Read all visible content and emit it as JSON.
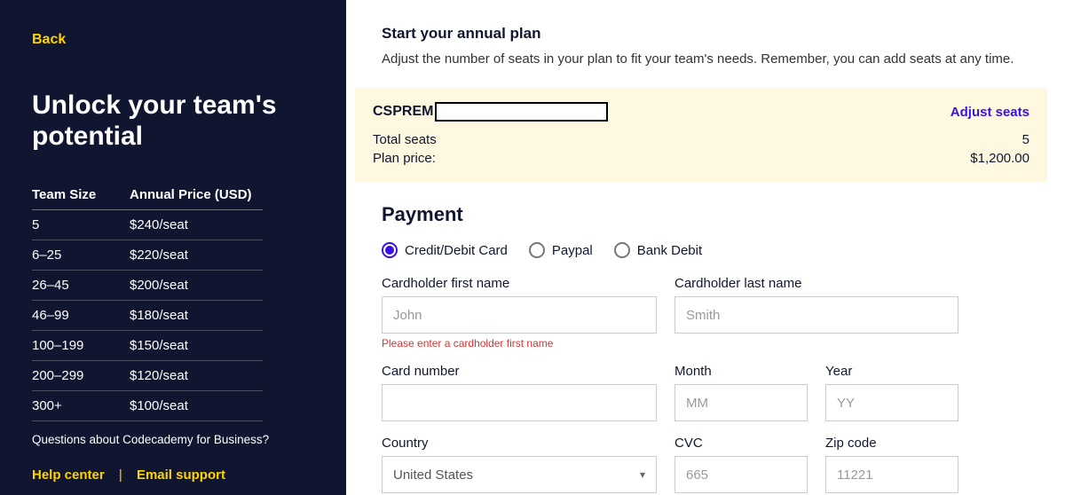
{
  "sidebar": {
    "back": "Back",
    "title": "Unlock your team's potential",
    "table": {
      "col_size": "Team Size",
      "col_price": "Annual Price (USD)",
      "rows": [
        {
          "size": "5",
          "price": "$240/seat"
        },
        {
          "size": "6–25",
          "price": "$220/seat"
        },
        {
          "size": "26–45",
          "price": "$200/seat"
        },
        {
          "size": "46–99",
          "price": "$180/seat"
        },
        {
          "size": "100–199",
          "price": "$150/seat"
        },
        {
          "size": "200–299",
          "price": "$120/seat"
        },
        {
          "size": "300+",
          "price": "$100/seat"
        }
      ]
    },
    "footer_note": "Questions about Codecademy for Business?",
    "help_center": "Help center",
    "email_support": "Email support"
  },
  "main": {
    "title": "Start your annual plan",
    "desc": "Adjust the number of seats in your plan to fit your team's needs. Remember, you can add seats at any time."
  },
  "summary": {
    "plan_code": "CSPREM",
    "adjust": "Adjust seats",
    "seats_label": "Total seats",
    "seats_value": "5",
    "price_label": "Plan price:",
    "price_value": "$1,200.00"
  },
  "payment": {
    "title": "Payment",
    "methods": {
      "card": "Credit/Debit Card",
      "paypal": "Paypal",
      "bank": "Bank Debit"
    },
    "fields": {
      "first_label": "Cardholder first name",
      "first_ph": "John",
      "first_error": "Please enter a cardholder first name",
      "last_label": "Cardholder last name",
      "last_ph": "Smith",
      "card_label": "Card number",
      "month_label": "Month",
      "month_ph": "MM",
      "year_label": "Year",
      "year_ph": "YY",
      "country_label": "Country",
      "country_value": "United States",
      "cvc_label": "CVC",
      "cvc_ph": "665",
      "zip_label": "Zip code",
      "zip_ph": "11221"
    }
  }
}
